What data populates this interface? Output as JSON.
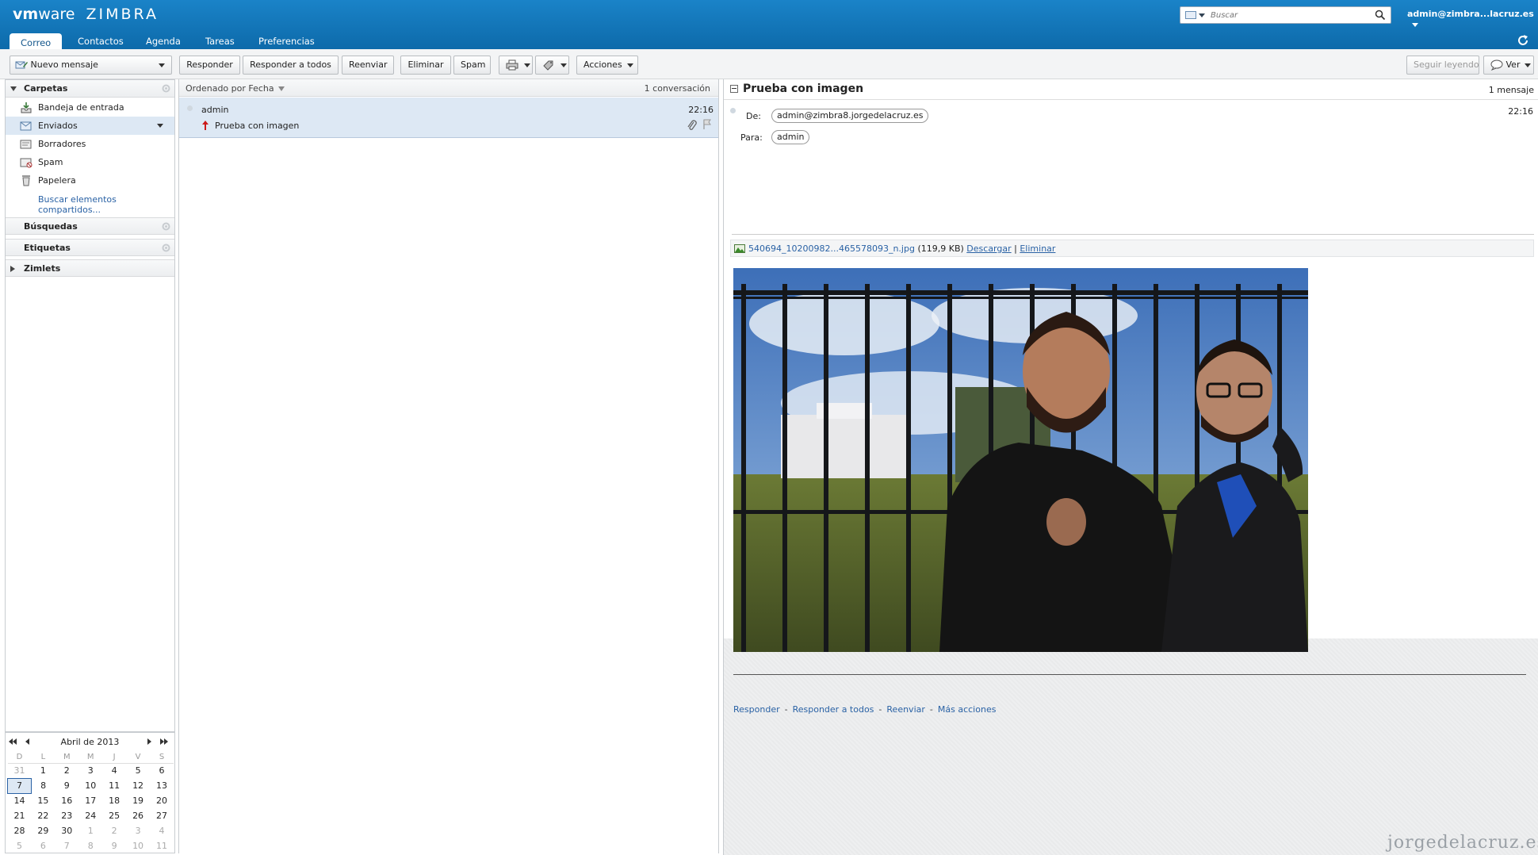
{
  "brand": {
    "logo_vm": "vm",
    "logo_ware": "ware",
    "logo_product": "ZIMBRA"
  },
  "search": {
    "placeholder": "Buscar"
  },
  "user": {
    "label": "admin@zimbra...lacruz.es"
  },
  "app_tabs": [
    {
      "label": "Correo",
      "active": true
    },
    {
      "label": "Contactos"
    },
    {
      "label": "Agenda"
    },
    {
      "label": "Tareas"
    },
    {
      "label": "Preferencias"
    }
  ],
  "toolbar": {
    "new_message": "Nuevo mensaje",
    "reply": "Responder",
    "reply_all": "Responder a todos",
    "forward": "Reenviar",
    "delete": "Eliminar",
    "spam": "Spam",
    "actions": "Acciones",
    "keep_reading": "Seguir leyendo",
    "view": "Ver"
  },
  "sidebar": {
    "folders_header": "Carpetas",
    "folders": [
      {
        "label": "Bandeja de entrada",
        "icon": "inbox-icon"
      },
      {
        "label": "Enviados",
        "icon": "sent-icon",
        "selected": true
      },
      {
        "label": "Borradores",
        "icon": "drafts-icon"
      },
      {
        "label": "Spam",
        "icon": "spam-icon"
      },
      {
        "label": "Papelera",
        "icon": "trash-icon"
      }
    ],
    "find_shares": "Buscar elementos compartidos...",
    "searches_header": "Búsquedas",
    "tags_header": "Etiquetas",
    "zimlets_header": "Zimlets"
  },
  "calendar": {
    "title": "Abril de 2013",
    "weekdays": [
      "D",
      "L",
      "M",
      "M",
      "J",
      "V",
      "S"
    ],
    "weeks": [
      [
        "31",
        "1",
        "2",
        "3",
        "4",
        "5",
        "6"
      ],
      [
        "7",
        "8",
        "9",
        "10",
        "11",
        "12",
        "13"
      ],
      [
        "14",
        "15",
        "16",
        "17",
        "18",
        "19",
        "20"
      ],
      [
        "21",
        "22",
        "23",
        "24",
        "25",
        "26",
        "27"
      ],
      [
        "28",
        "29",
        "30",
        "1",
        "2",
        "3",
        "4"
      ],
      [
        "5",
        "6",
        "7",
        "8",
        "9",
        "10",
        "11"
      ]
    ],
    "today": "7"
  },
  "list": {
    "sort_label": "Ordenado por Fecha",
    "count": "1 conversación",
    "messages": [
      {
        "from": "admin",
        "time": "22:16",
        "subject": "Prueba con imagen"
      }
    ]
  },
  "reading": {
    "subject": "Prueba con imagen",
    "count": "1 mensaje",
    "time": "22:16",
    "from_label": "De:",
    "from": "admin@zimbra8.jorgedelacruz.es",
    "to_label": "Para:",
    "to": "admin",
    "attachment": {
      "name": "540694_10200982...465578093_n.jpg",
      "size": "(119,9 KB)",
      "download": "Descargar",
      "sep": "|",
      "remove": "Eliminar"
    },
    "actions": [
      "Responder",
      "Responder a todos",
      "Reenviar",
      "Más acciones"
    ]
  },
  "watermark": "jorgedelacruz.es"
}
